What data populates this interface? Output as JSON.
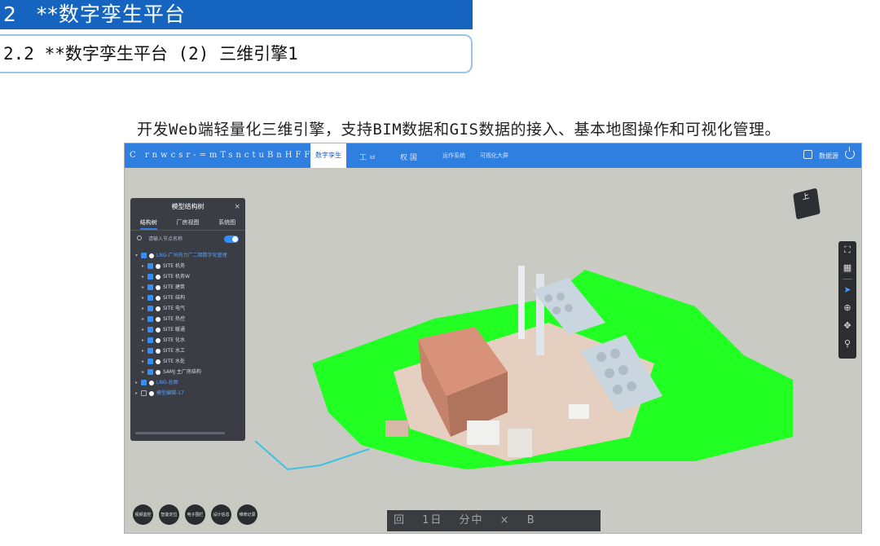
{
  "slide": {
    "section_number": "2",
    "section_title": "**数字孪生平台",
    "subtitle": "2.2 **数字孪生平台 (2) 三维引擎1",
    "description": "开发Web端轻量化三维引擎，支持BIM数据和GIS数据的接入、基本地图操作和可视化管理。"
  },
  "app": {
    "brand": "C rnwcsr-=mTsnctuBnHFFa",
    "active_tab": "数字孪生",
    "tabs": [
      "工 ㅂ",
      "权 国",
      "运作系统",
      "可视化大屏"
    ],
    "user_label": "数据源",
    "panel": {
      "title": "模型结构树",
      "tabs": [
        "结构树",
        "厂房视图",
        "系统图"
      ],
      "search_placeholder": "请输入节点名称",
      "tree": [
        {
          "label": "LNG-广州热力广二期数字化管理",
          "level": 0,
          "checked": true
        },
        {
          "label": "SITE 机务",
          "level": 1,
          "checked": true
        },
        {
          "label": "SITE 机务W",
          "level": 1,
          "checked": true
        },
        {
          "label": "SITE 建筑",
          "level": 1,
          "checked": true
        },
        {
          "label": "SITE 结构",
          "level": 1,
          "checked": true
        },
        {
          "label": "SITE 电气",
          "level": 1,
          "checked": true
        },
        {
          "label": "SITE 热控",
          "level": 1,
          "checked": true
        },
        {
          "label": "SITE 暖通",
          "level": 1,
          "checked": true
        },
        {
          "label": "SITE 化水",
          "level": 1,
          "checked": true
        },
        {
          "label": "SITE 水工",
          "level": 1,
          "checked": true
        },
        {
          "label": "SITE 水处",
          "level": 1,
          "checked": true
        },
        {
          "label": "SAMJ 主厂房结构",
          "level": 1,
          "checked": true
        },
        {
          "label": "LNG-总图",
          "level": 0,
          "checked": true
        },
        {
          "label": "模型编辑-17",
          "level": 0,
          "checked": false
        }
      ]
    },
    "nav_cube": "上",
    "right_tools": [
      "fit-icon",
      "grid-icon",
      "select-icon",
      "rotate-icon",
      "pan-icon",
      "zoom-icon"
    ],
    "bottom_tools": [
      "视频监控",
      "智能定位",
      "电子围栏",
      "设计信息",
      "维修记录"
    ],
    "caption": "回 1日 分中 × B",
    "colors": {
      "topbar": "#2f7fe0",
      "ground": "#22ff22",
      "building": "#d9927a",
      "panel_bg": "#3a3d44"
    }
  }
}
